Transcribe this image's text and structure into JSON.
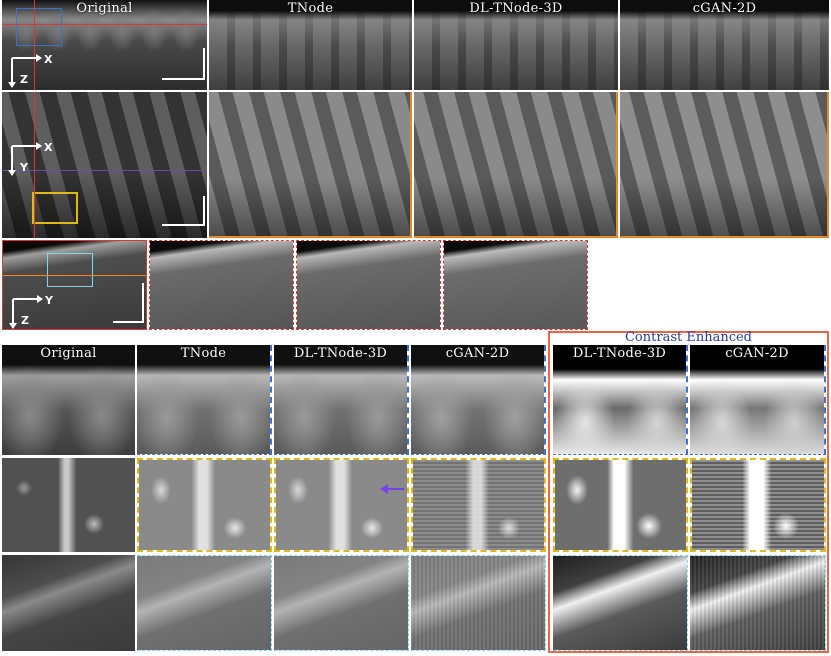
{
  "columns": {
    "original": "Original",
    "tnode": "TNode",
    "dl": "DL-TNode-3D",
    "cgan": "cGAN-2D"
  },
  "axes": {
    "xz": [
      "X",
      "Z"
    ],
    "xy": [
      "X",
      "Y"
    ],
    "yz": [
      "Y",
      "Z"
    ]
  },
  "contrast_title": "Contrast Enhanced",
  "colors": {
    "orange": "#e8872a",
    "red": "#d33a3a",
    "blue": "#3b74c9",
    "yellow": "#e0b818",
    "cyan": "#7fd8e6",
    "purple": "#7a3fe8",
    "contrast_box": "#e8664a",
    "contrast_text": "#2a3a9a"
  },
  "icons": [
    "axis-arrow-icon",
    "purple-arrow-icon"
  ]
}
